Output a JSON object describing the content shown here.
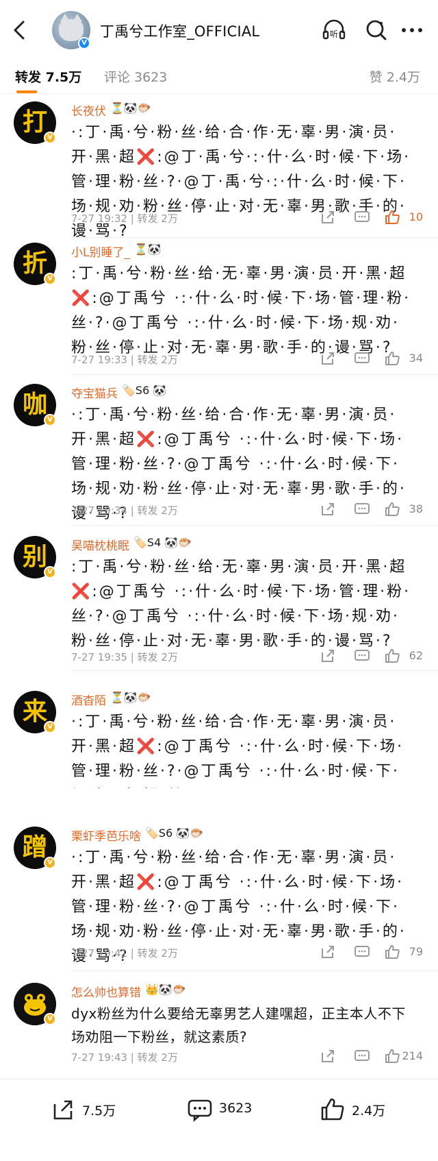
{
  "header": {
    "title": "丁禹兮工作室_OFFICIAL",
    "icons": [
      "back-icon",
      "headphone-listen-icon",
      "search-icon",
      "more-icon"
    ],
    "listen_label": "听"
  },
  "tabs": {
    "repost": "转发 7.5万",
    "comment": "评论 3623",
    "likes": "赞 2.4万",
    "accent": "#ff8200"
  },
  "comments": [
    {
      "avatar_char": "打",
      "name": "长夜伏",
      "badges": "⏳🐼🐡",
      "text": "·:丁·禹·兮·粉·丝·给·合·作·无·辜·男·演·员·开·黑·超❌:@丁·禹·兮·:·什·么·时·候·下·场·管·理·粉·丝·?·@丁·禹·兮·:·什·么·时·候·下·场·规·劝·粉·丝·停·止·对·无·辜·男·歌·手·的·谩·骂·?",
      "meta": "7-27 19:32 | 转发 2万",
      "likes": "10"
    },
    {
      "avatar_char": "折",
      "name": "小L别睡了_",
      "badges": "⏳🐼",
      "text": ":丁·禹·兮·粉·丝·给·无·辜·男·演·员·开·黑·超❌:@丁禹兮 ·:·什·么·时·候·下·场·管·理·粉·丝·?·@丁禹兮 ·:·什·么·时·候·下·场·规·劝·粉·丝·停·止·对·无·辜·男·歌·手·的·谩·骂·?",
      "meta": "7-27 19:33 | 转发 2万",
      "likes": "34"
    },
    {
      "avatar_char": "咖",
      "name": "夺宝猫兵",
      "badges": "🏷️S6 🐼",
      "text": "·:丁·禹·兮·粉·丝·给·合·作·无·辜·男·演·员·开·黑·超❌:@丁禹兮 ·:·什·么·时·候·下·场·管·理·粉·丝·?·@丁禹兮 ·:·什·么·时·候·下·场·规·劝·粉·丝·停·止·对·无·辜·男·歌·手·的·谩·骂·?",
      "meta": "7-27 19:34 | 转发 2万",
      "likes": "38"
    },
    {
      "avatar_char": "别",
      "name": "昊喵枕桃眠",
      "badges": "🏷️S4 🐼🐡",
      "text": ":丁·禹·兮·粉·丝·给·无·辜·男·演·员·开·黑·超❌:@丁禹兮 ·:·什·么·时·候·下·场·管·理·粉·丝·?·@丁禹兮 ·:·什·么·时·候·下·场·规·劝·粉·丝·停·止·对·无·辜·男·歌·手·的·谩·骂·?",
      "meta": "7-27 19:35 | 转发 2万",
      "likes": "62"
    },
    {
      "avatar_char": "来",
      "name": "酒杳陌",
      "badges": "⏳🐼🐡",
      "text": "·:丁·禹·兮·粉·丝·给·合·作·无·辜·男·演·员·开·黑·超❌:@丁禹兮 ·:·什·么·时·候·下·场·管·理·粉·丝·?·@丁禹兮 ·:·什·么·时·候·下·场·规·劝·粉·丝",
      "meta": "",
      "likes": ""
    },
    {
      "avatar_char": "蹭",
      "name": "栗虾季芭乐啥",
      "badges": "🏷️S6 🐼🐡",
      "text": "·:丁·禹·兮·粉·丝·给·合·作·无·辜·男·演·员·开·黑·超❌:@丁禹兮 ·:·什·么·时·候·下·场·管·理·粉·丝·?·@丁禹兮 ·:·什·么·时·候·下·场·规·劝·粉·丝·停·止·对·无·辜·男·歌·手·的·谩·骂·?",
      "meta": "7-27 19:41 | 转发 2万",
      "likes": "79"
    },
    {
      "avatar_char": "",
      "name": "怎么帅也算错",
      "badges": "👑🐼🐡",
      "text": "dyx粉丝为什么要给无辜男艺人建嘿超，正主本人不下场劝阻一下粉丝，就这素质?",
      "meta": "7-27 19:43 | 转发 2万",
      "likes": "214"
    }
  ],
  "bottom_bar": {
    "share_count": "7.5万",
    "comment_count": "3623",
    "like_count": "2.4万"
  }
}
